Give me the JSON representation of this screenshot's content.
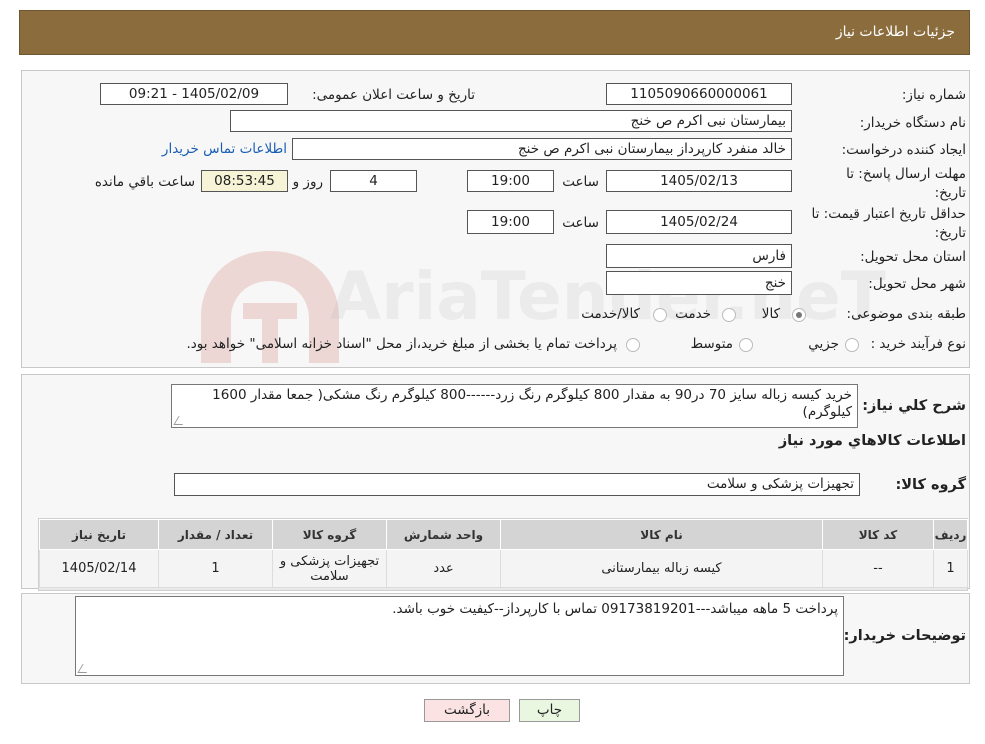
{
  "header": {
    "title": "جزئیات اطلاعات نیاز"
  },
  "form": {
    "need_number_label": "شماره نیاز:",
    "need_number": "1105090660000061",
    "announce_label": "تاریخ و ساعت اعلان عمومی:",
    "announce_value": "1405/02/09 - 09:21",
    "buyer_org_label": "نام دستگاه خریدار:",
    "buyer_org": "بیمارستان نبی اکرم  ص  خنج",
    "creator_label": "ایجاد کننده درخواست:",
    "creator": "خالد منفرد کارپرداز بیمارستان نبی اکرم  ص  خنج",
    "contact_link": "اطلاعات تماس خریدار",
    "deadline_label_line1": "مهلت ارسال پاسخ: تا",
    "deadline_label_line2": "تاریخ:",
    "deadline_date": "1405/02/13",
    "time_label": "ساعت",
    "deadline_time": "19:00",
    "days_value": "4",
    "days_label": "روز و",
    "remaining_time": "08:53:45",
    "remaining_label": "ساعت باقي مانده",
    "validity_label_line1": "حداقل تاریخ اعتبار قیمت: تا",
    "validity_label_line2": "تاریخ:",
    "validity_date": "1405/02/24",
    "validity_time": "19:00",
    "province_label": "استان محل تحویل:",
    "province": "فارس",
    "city_label": "شهر محل تحویل:",
    "city": "خنج",
    "category_label": "طبقه بندی موضوعی:",
    "category_options": [
      "کالا",
      "خدمت",
      "کالا/خدمت"
    ],
    "category_selected": "کالا",
    "process_label": "نوع فرآیند خرید :",
    "process_options": [
      "جزیي",
      "متوسط"
    ],
    "process_note": "پرداخت تمام یا بخشی از مبلغ خرید،از محل \"اسناد خزانه اسلامی\" خواهد بود."
  },
  "summary": {
    "label": "شرح کلي نياز:",
    "text": "خرید کیسه زباله سایز 70 در90 به مقدار 800 کیلوگرم رنگ زرد------800 کیلوگرم رنگ مشکی( جمعا مقدار 1600 کیلوگرم)"
  },
  "goods_section_title": "اطلاعات کالاهاي مورد نياز",
  "goods_group": {
    "label": "گروه کالا:",
    "value": "تجهیزات پزشکی و سلامت"
  },
  "table": {
    "headers": [
      "ردیف",
      "کد کالا",
      "نام کالا",
      "واحد شمارش",
      "گروه کالا",
      "تعداد / مقدار",
      "تاریخ نیاز"
    ],
    "rows": [
      [
        "1",
        "--",
        "کیسه زباله بیمارستانی",
        "عدد",
        "تجهیزات پزشکی و سلامت",
        "1",
        "1405/02/14"
      ]
    ]
  },
  "buyer_notes": {
    "label": "توضیحات خریدار:",
    "text": "پرداخت 5 ماهه میباشد---09173819201 تماس با کارپرداز--کیفیت خوب باشد."
  },
  "buttons": {
    "print": "چاپ",
    "back": "بازگشت"
  },
  "watermark": {
    "text": "AriaTender.neT"
  },
  "colors": {
    "header_bg": "#8b6c3c",
    "print_btn": "#e9f7e1",
    "back_btn": "#fbe3e3",
    "link": "#1a5fb4"
  }
}
